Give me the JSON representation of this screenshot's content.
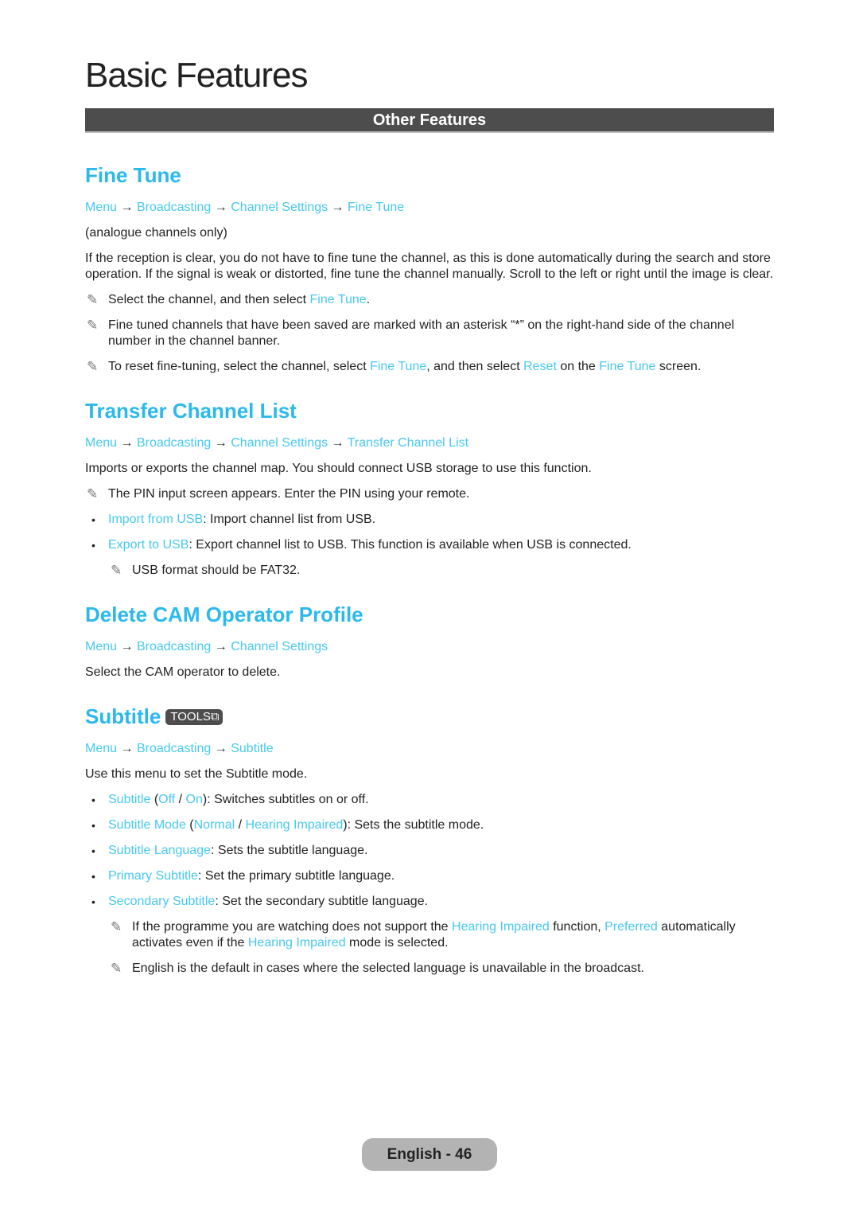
{
  "page_title": "Basic Features",
  "section_bar": "Other Features",
  "colors": {
    "accent": "#46c8f0",
    "heading": "#2bb9ec",
    "bar": "#4d4d4d",
    "footer": "#b3b3b3"
  },
  "arrow": "→",
  "pencil_icon": "✎",
  "bullet": "•",
  "fine_tune": {
    "title": "Fine Tune",
    "crumbs": [
      "Menu",
      "Broadcasting",
      "Channel Settings",
      "Fine Tune"
    ],
    "note_analogue": "(analogue channels only)",
    "description": "If the reception is clear, you do not have to fine tune the channel, as this is done automatically during the search and store operation. If the signal is weak or distorted, fine tune the channel manually. Scroll to the left or right until the image is clear.",
    "note1_a": "Select the channel, and then select ",
    "note1_link": "Fine Tune",
    "note1_b": ".",
    "note2": "Fine tuned channels that have been saved are marked with an asterisk “*” on the right-hand side of the channel number in the channel banner.",
    "note3_a": "To reset fine-tuning, select the channel, select ",
    "note3_link1": "Fine Tune",
    "note3_b": ", and then select ",
    "note3_link2": "Reset",
    "note3_c": " on the ",
    "note3_link3": "Fine Tune",
    "note3_d": " screen."
  },
  "transfer": {
    "title": "Transfer Channel List",
    "crumbs": [
      "Menu",
      "Broadcasting",
      "Channel Settings",
      "Transfer Channel List"
    ],
    "description": "Imports or exports the channel map. You should connect USB storage to use this function.",
    "note": "The PIN input screen appears. Enter the PIN using your remote.",
    "items": [
      {
        "link": "Import from USB",
        "text": ": Import channel list from USB."
      },
      {
        "link": "Export to USB",
        "text": ": Export channel list to USB. This function is available when USB is connected."
      }
    ],
    "subnote": "USB format should be FAT32."
  },
  "cam": {
    "title": "Delete CAM Operator Profile",
    "crumbs": [
      "Menu",
      "Broadcasting",
      "Channel Settings"
    ],
    "description": "Select the CAM operator to delete."
  },
  "subtitle": {
    "title": "Subtitle",
    "tools_badge": "TOOLS",
    "tools_icon": "⧉",
    "crumbs": [
      "Menu",
      "Broadcasting",
      "Subtitle"
    ],
    "description": "Use this menu to set the Subtitle mode.",
    "item1": {
      "link": "Subtitle",
      "p1": " (",
      "opt1": "Off",
      "sep": " / ",
      "opt2": "On",
      "text": "): Switches subtitles on or off."
    },
    "item2": {
      "link": "Subtitle Mode",
      "p1": " (",
      "opt1": "Normal",
      "sep": " / ",
      "opt2": "Hearing Impaired",
      "text": "): Sets the subtitle mode."
    },
    "item3": {
      "link": "Subtitle Language",
      "text": ": Sets the subtitle language."
    },
    "item4": {
      "link": "Primary Subtitle",
      "text": ": Set the primary subtitle language."
    },
    "item5": {
      "link": "Secondary Subtitle",
      "text": ": Set the secondary subtitle language."
    },
    "subnote1": {
      "a": "If the programme you are watching does not support the ",
      "l1": "Hearing Impaired",
      "b": " function, ",
      "l2": "Preferred",
      "c": " automatically activates even if the ",
      "l3": "Hearing Impaired",
      "d": " mode is selected."
    },
    "subnote2": "English is the default in cases where the selected language is unavailable in the broadcast."
  },
  "footer": "English - 46"
}
